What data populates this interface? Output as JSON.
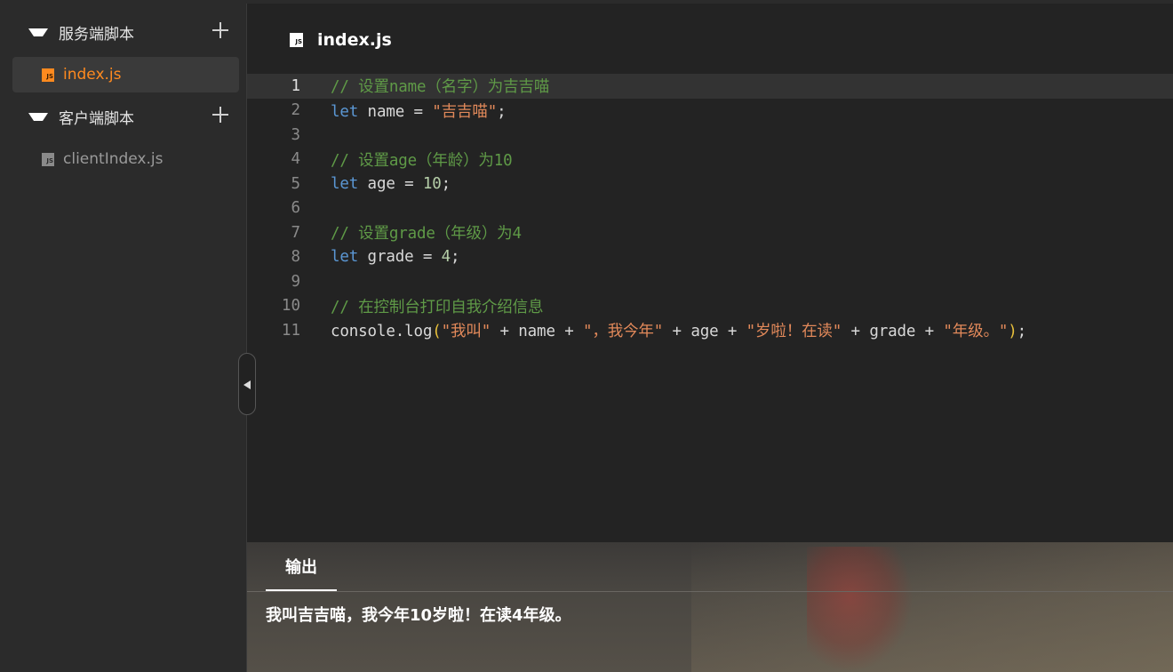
{
  "sidebar": {
    "server_folder": "服务端脚本",
    "server_files": [
      "index.js"
    ],
    "client_folder": "客户端脚本",
    "client_files": [
      "clientIndex.js"
    ]
  },
  "editor": {
    "tab_title": "index.js",
    "active_line": 1,
    "lines": [
      {
        "n": "1",
        "tokens": [
          {
            "t": "cm",
            "v": "// 设置name（名字）为吉吉喵"
          }
        ]
      },
      {
        "n": "2",
        "tokens": [
          {
            "t": "kw",
            "v": "let"
          },
          {
            "t": "id",
            "v": " name = "
          },
          {
            "t": "str",
            "v": "\"吉吉喵\""
          },
          {
            "t": "id",
            "v": ";"
          }
        ]
      },
      {
        "n": "3",
        "tokens": []
      },
      {
        "n": "4",
        "tokens": [
          {
            "t": "cm",
            "v": "// 设置age（年龄）为10"
          }
        ]
      },
      {
        "n": "5",
        "tokens": [
          {
            "t": "kw",
            "v": "let"
          },
          {
            "t": "id",
            "v": " age = "
          },
          {
            "t": "num",
            "v": "10"
          },
          {
            "t": "id",
            "v": ";"
          }
        ]
      },
      {
        "n": "6",
        "tokens": []
      },
      {
        "n": "7",
        "tokens": [
          {
            "t": "cm",
            "v": "// 设置grade（年级）为4"
          }
        ]
      },
      {
        "n": "8",
        "tokens": [
          {
            "t": "kw",
            "v": "let"
          },
          {
            "t": "id",
            "v": " grade = "
          },
          {
            "t": "num",
            "v": "4"
          },
          {
            "t": "id",
            "v": ";"
          }
        ]
      },
      {
        "n": "9",
        "tokens": []
      },
      {
        "n": "10",
        "tokens": [
          {
            "t": "cm",
            "v": "// 在控制台打印自我介绍信息"
          }
        ]
      },
      {
        "n": "11",
        "tokens": [
          {
            "t": "id",
            "v": "console.log"
          },
          {
            "t": "paren",
            "v": "("
          },
          {
            "t": "str",
            "v": "\"我叫\""
          },
          {
            "t": "id",
            "v": " + name + "
          },
          {
            "t": "str",
            "v": "\"，我今年\""
          },
          {
            "t": "id",
            "v": " + age + "
          },
          {
            "t": "str",
            "v": "\"岁啦！在读\""
          },
          {
            "t": "id",
            "v": " + grade + "
          },
          {
            "t": "str",
            "v": "\"年级。\""
          },
          {
            "t": "paren",
            "v": ")"
          },
          {
            "t": "id",
            "v": ";"
          }
        ]
      }
    ]
  },
  "output": {
    "tab_label": "输出",
    "text": "我叫吉吉喵，我今年10岁啦！在读4年级。"
  },
  "icons": {
    "folder_toggle": "triangle-down-icon",
    "add": "plus-icon",
    "file": "js-file-icon",
    "collapse": "chevron-left-icon"
  },
  "colors": {
    "active_file": "#ff8a1f",
    "comment": "#5f9a47",
    "keyword": "#5b97d4",
    "string": "#e2895a",
    "number": "#b5cea8"
  }
}
